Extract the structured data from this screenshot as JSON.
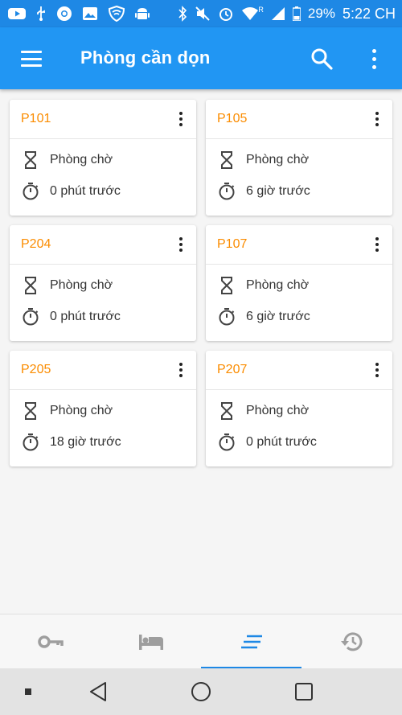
{
  "status_bar": {
    "battery": "29%",
    "time": "5:22 CH",
    "signal_badge": "R"
  },
  "app_bar": {
    "title": "Phòng cần dọn"
  },
  "rooms": [
    {
      "number": "P101",
      "status": "Phòng chờ",
      "elapsed": "0 phút trước"
    },
    {
      "number": "P105",
      "status": "Phòng chờ",
      "elapsed": "6 giờ trước"
    },
    {
      "number": "P204",
      "status": "Phòng chờ",
      "elapsed": "0 phút trước"
    },
    {
      "number": "P107",
      "status": "Phòng chờ",
      "elapsed": "6 giờ trước"
    },
    {
      "number": "P205",
      "status": "Phòng chờ",
      "elapsed": "18 giờ trước"
    },
    {
      "number": "P207",
      "status": "Phòng chờ",
      "elapsed": "0 phút trước"
    }
  ],
  "bottom_nav": {
    "items": [
      {
        "icon": "key-icon",
        "active": false
      },
      {
        "icon": "bed-icon",
        "active": false
      },
      {
        "icon": "list-icon",
        "active": true
      },
      {
        "icon": "history-icon",
        "active": false
      }
    ]
  },
  "colors": {
    "primary": "#2196f3",
    "status_bar": "#1e88e5",
    "room_number": "#fb8c00",
    "active_tab": "#1e88e5"
  }
}
